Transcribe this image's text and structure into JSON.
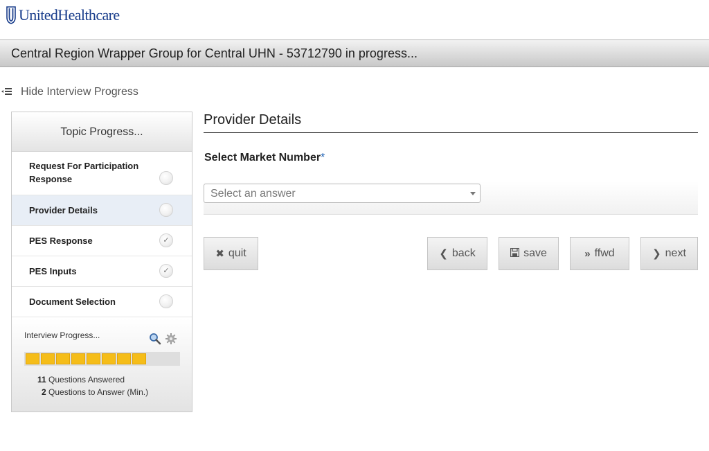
{
  "header": {
    "logo_text": "UnitedHealthcare",
    "title": "Central Region Wrapper Group for Central UHN - 53712790 in progress..."
  },
  "toggle": {
    "icon": "hamburger-collapse-icon",
    "label": "Hide Interview Progress"
  },
  "sidebar": {
    "title": "Topic Progress...",
    "topics": [
      {
        "label": "Request For Participation Response",
        "status": "incomplete"
      },
      {
        "label": "Provider Details",
        "status": "current"
      },
      {
        "label": "PES Response",
        "status": "complete"
      },
      {
        "label": "PES Inputs",
        "status": "complete"
      },
      {
        "label": "Document Selection",
        "status": "incomplete"
      }
    ],
    "progress": {
      "title": "Interview Progress...",
      "completed_fraction": 0.8,
      "segments_filled": 8,
      "answered_count": "11",
      "answered_label": "Questions Answered",
      "remaining_count": "2",
      "remaining_label": "Questions to Answer (Min.)"
    }
  },
  "main": {
    "heading": "Provider Details",
    "question": {
      "label": "Select Market Number",
      "required_mark": "*"
    },
    "select": {
      "placeholder": "Select an answer"
    }
  },
  "buttons": {
    "quit": "quit",
    "back": "back",
    "save": "save",
    "ffwd": "ffwd",
    "next": "next"
  },
  "colors": {
    "brand_blue": "#1a3e8c",
    "progress_fill": "#f5bd19",
    "active_topic_bg": "#e8eef6"
  }
}
